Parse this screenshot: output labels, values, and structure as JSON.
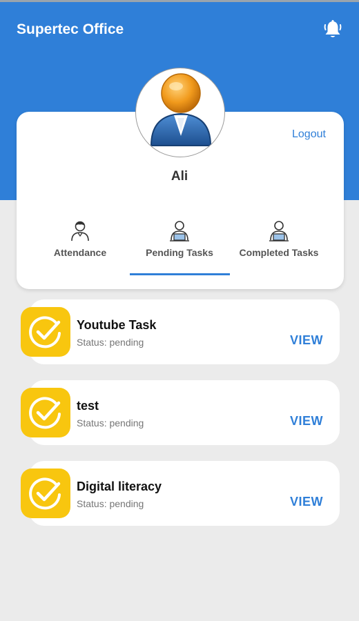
{
  "app": {
    "title": "Supertec Office"
  },
  "header": {
    "bell_icon": "bell-icon",
    "color": "#2f7fd8"
  },
  "profile": {
    "name": "Ali",
    "logout_label": "Logout",
    "avatar_icon": "user-avatar-icon"
  },
  "tabs": [
    {
      "label": "Attendance",
      "icon": "person-icon",
      "selected": false
    },
    {
      "label": "Pending Tasks",
      "icon": "person-laptop-icon",
      "selected": true
    },
    {
      "label": "Completed Tasks",
      "icon": "person-laptop-icon",
      "selected": false
    }
  ],
  "tasks": [
    {
      "title": "Youtube Task",
      "status": "Status: pending",
      "action": "VIEW",
      "icon": "check-circle-icon"
    },
    {
      "title": "test",
      "status": "Status: pending",
      "action": "VIEW",
      "icon": "check-circle-icon"
    },
    {
      "title": "Digital literacy",
      "status": "Status: pending",
      "action": "VIEW",
      "icon": "check-circle-icon"
    }
  ],
  "colors": {
    "accent": "#2f7fd8",
    "task_icon_bg": "#f8c60f",
    "background": "#ebebeb"
  }
}
